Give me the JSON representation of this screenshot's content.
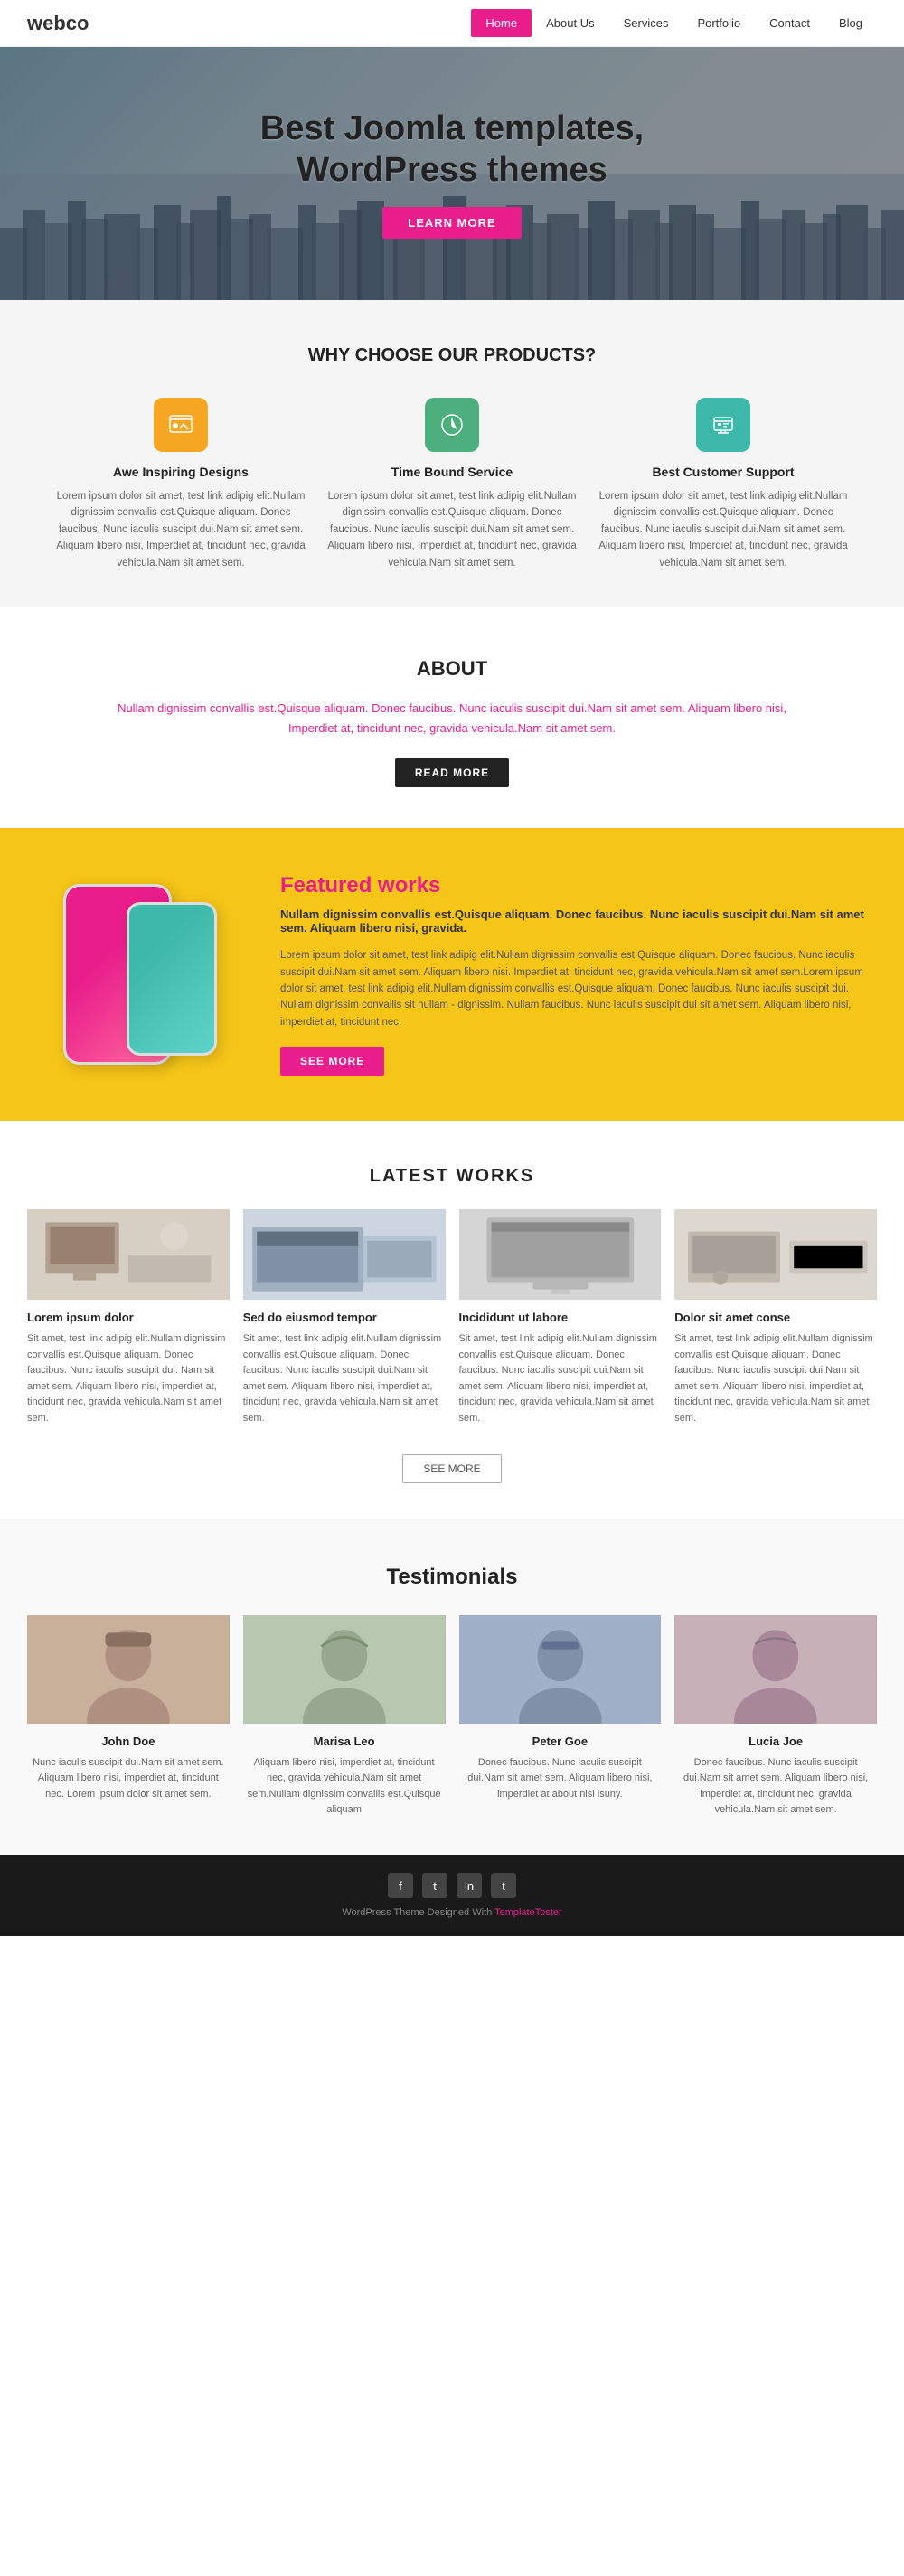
{
  "brand": "webco",
  "nav": {
    "items": [
      {
        "label": "Home",
        "active": true
      },
      {
        "label": "About Us",
        "active": false
      },
      {
        "label": "Services",
        "active": false
      },
      {
        "label": "Portfolio",
        "active": false
      },
      {
        "label": "Contact",
        "active": false
      },
      {
        "label": "Blog",
        "active": false
      }
    ]
  },
  "hero": {
    "line1": "Best Joomla templates,",
    "line2": "WordPress themes",
    "cta": "LEARN MORE"
  },
  "why": {
    "title": "WHY CHOOSE OUR PRODUCTS?",
    "features": [
      {
        "icon": "🖼",
        "title": "Awe Inspiring Designs",
        "text": "Lorem ipsum dolor sit amet, test link adipig elit.Nullam dignissim convallis est.Quisque aliquam. Donec faucibus. Nunc iaculis suscipit dui.Nam sit amet sem. Aliquam libero nisi, Imperdiet at, tincidunt nec, gravida vehicula.Nam sit amet sem."
      },
      {
        "icon": "🕐",
        "title": "Time Bound Service",
        "text": "Lorem ipsum dolor sit amet, test link adipig elit.Nullam dignissim convallis est.Quisque aliquam. Donec faucibus. Nunc iaculis suscipit dui.Nam sit amet sem. Aliquam libero nisi, Imperdiet at, tincidunt nec, gravida vehicula.Nam sit amet sem."
      },
      {
        "icon": "📊",
        "title": "Best Customer Support",
        "text": "Lorem ipsum dolor sit amet, test link adipig elit.Nullam dignissim convallis est.Quisque aliquam. Donec faucibus. Nunc iaculis suscipit dui.Nam sit amet sem. Aliquam libero nisi, Imperdiet at, tincidunt nec, gravida vehicula.Nam sit amet sem."
      }
    ]
  },
  "about": {
    "title": "ABOUT",
    "text": "Nullam dignissim convallis est.Quisque aliquam. Donec faucibus. Nunc iaculis suscipit dui.Nam sit amet sem. Aliquam libero nisi, Imperdiet at, tincidunt nec, gravida vehicula.Nam sit amet sem.",
    "cta": "READ MORE"
  },
  "featured": {
    "title": "Featured works",
    "subtitle": "Nullam dignissim convallis est.Quisque aliquam. Donec faucibus. Nunc iaculis suscipit dui.Nam sit amet sem. Aliquam libero nisi, gravida.",
    "text": "Lorem ipsum dolor sit amet, test link adipig elit.Nullam dignissim convallis est.Quisque aliquam. Donec faucibus. Nunc iaculis suscipit dui.Nam sit amet sem. Aliquam libero nisi. Imperdiet at, tincidunt nec, gravida vehicula.Nam sit amet sem.Lorem ipsum dolor sit amet, test link adipig elit.Nullam dignissim convallis est.Quisque aliquam. Donec faucibus. Nunc iaculis suscipit dui. Nullam dignissim convallis sit nullam - dignissim. Nullam faucibus. Nunc iaculis suscipit dui sit amet sem. Aliquam libero nisi, imperdiet at, tincidunt nec.",
    "cta": "SEE MORE"
  },
  "latest": {
    "title": "LATEST WORKS",
    "items": [
      {
        "title": "Lorem ipsum dolor",
        "text": "Sit amet, test link adipig elit.Nullam dignissim convallis est.Quisque aliquam. Donec faucibus. Nunc iaculis suscipit dui. Nam sit amet sem. Aliquam libero nisi, imperdiet at, tincidunt nec, gravida vehicula.Nam sit amet sem."
      },
      {
        "title": "Sed do eiusmod tempor",
        "text": "Sit amet, test link adipig elit.Nullam dignissim convallis est.Quisque aliquam. Donec faucibus. Nunc iaculis suscipit dui.Nam sit amet sem. Aliquam libero nisi, imperdiet at, tincidunt nec, gravida vehicula.Nam sit amet sem."
      },
      {
        "title": "Incididunt ut labore",
        "text": "Sit amet, test link adipig elit.Nullam dignissim convallis est.Quisque aliquam. Donec faucibus. Nunc iaculis suscipit dui.Nam sit amet sem. Aliquam libero nisi, imperdiet at, tincidunt nec, gravida vehicula.Nam sit amet sem."
      },
      {
        "title": "Dolor sit amet conse",
        "text": "Sit amet, test link adipig elit.Nullam dignissim convallis est.Quisque aliquam. Donec faucibus. Nunc iaculis suscipit dui.Nam sit amet sem. Aliquam libero nisi, imperdiet at, tincidunt nec, gravida vehicula.Nam sit amet sem."
      }
    ],
    "cta": "SEE MORE"
  },
  "testimonials": {
    "title": "Testimonials",
    "items": [
      {
        "name": "John Doe",
        "text": "Nunc iaculis suscipit dui.Nam sit amet sem. Aliquam libero nisi, imperdiet at, tincidunt nec. Lorem ipsum dolor sit amet sem."
      },
      {
        "name": "Marisa Leo",
        "text": "Aliquam libero nisi, imperdiet at, tincidunt nec, gravida vehicula.Nam sit amet sem.Nullam dignissim convallis est.Quisque aliquam"
      },
      {
        "name": "Peter Goe",
        "text": "Donec faucibus. Nunc iaculis suscipit dui.Nam sit amet sem. Aliquam libero nisi, imperdiet at about nisi isuny."
      },
      {
        "name": "Lucia Joe",
        "text": "Donec faucibus. Nunc iaculis suscipit dui.Nam sit amet sem. Aliquam libero nisi, imperdiet at, tincidunt nec, gravida vehicula.Nam sit amet sem."
      }
    ]
  },
  "footer": {
    "social": [
      {
        "label": "f",
        "name": "facebook"
      },
      {
        "label": "t",
        "name": "twitter"
      },
      {
        "label": "in",
        "name": "linkedin"
      },
      {
        "label": "t2",
        "name": "tumblr"
      }
    ],
    "text": "WordPress Theme Designed With TemplateToster"
  }
}
